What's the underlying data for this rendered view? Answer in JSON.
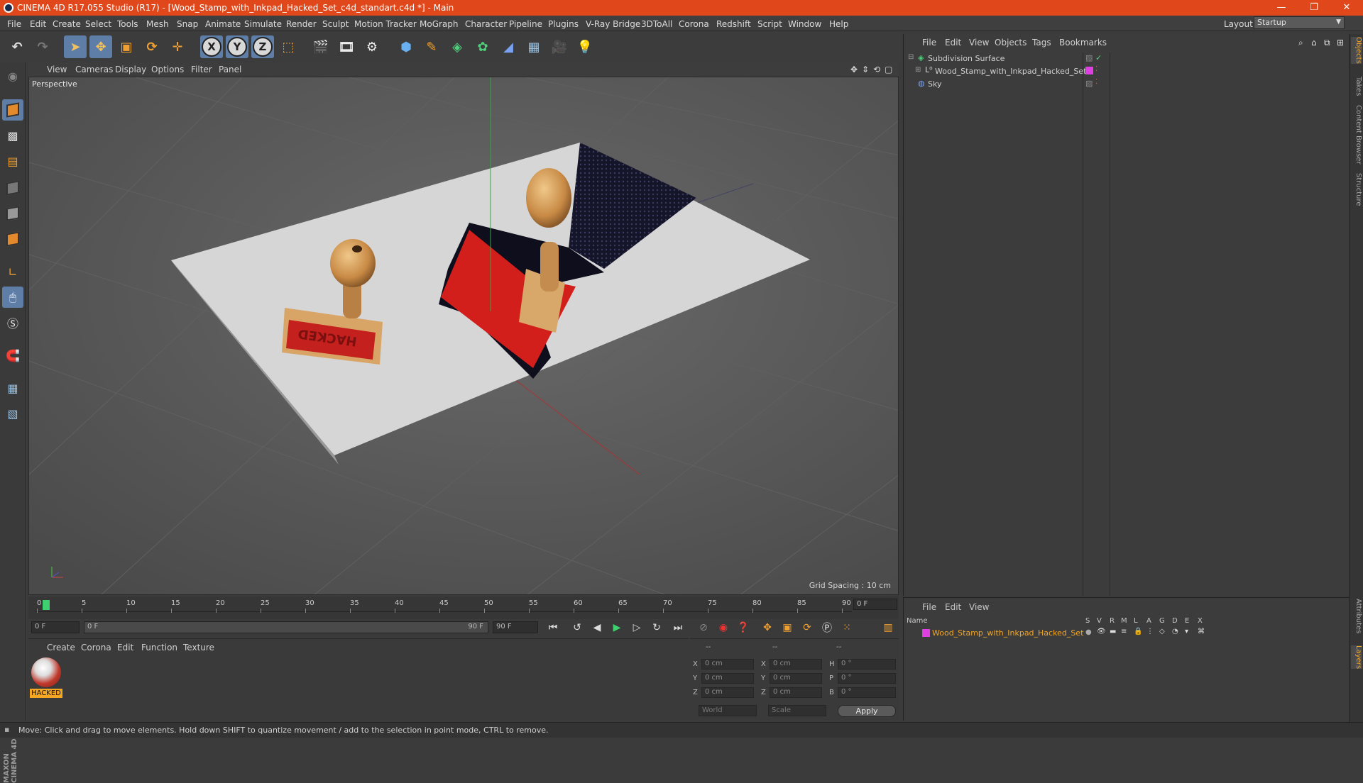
{
  "window": {
    "title": "CINEMA 4D R17.055 Studio (R17) - [Wood_Stamp_with_Inkpad_Hacked_Set_c4d_standart.c4d *] - Main",
    "minimize": "—",
    "restore": "❐",
    "close": "✕"
  },
  "menu": {
    "items": [
      "File",
      "Edit",
      "Create",
      "Select",
      "Tools",
      "Mesh",
      "Snap",
      "Animate",
      "Simulate",
      "Render",
      "Sculpt",
      "Motion Tracker",
      "MoGraph",
      "Character",
      "Pipeline",
      "Plugins",
      "V-Ray Bridge",
      "3DToAll",
      "Corona",
      "Redshift",
      "Script",
      "Window",
      "Help"
    ],
    "layout_label": "Layout:",
    "layout_value": "Startup"
  },
  "toolbar": {
    "x_label": "X",
    "y_label": "Y",
    "z_label": "Z"
  },
  "viewport": {
    "menu": [
      "View",
      "Cameras",
      "Display",
      "Options",
      "Filter",
      "Panel"
    ],
    "label": "Perspective",
    "grid_spacing": "Grid Spacing : 10 cm",
    "stamp_text": "HACKED"
  },
  "timeline": {
    "ticks": [
      "0",
      "5",
      "10",
      "15",
      "20",
      "25",
      "30",
      "35",
      "40",
      "45",
      "50",
      "55",
      "60",
      "65",
      "70",
      "75",
      "80",
      "85",
      "90"
    ],
    "current_frame": "0 F",
    "start_field": "0 F",
    "range_start": "0 F",
    "range_end": "90 F",
    "end_field": "90 F"
  },
  "material": {
    "menu": [
      "Create",
      "Corona",
      "Edit",
      "Function",
      "Texture"
    ],
    "name": "HACKED"
  },
  "coordinates": {
    "header": [
      "--",
      "--",
      "--"
    ],
    "rows": [
      {
        "l1": "X",
        "v1": "0 cm",
        "l2": "X",
        "v2": "0 cm",
        "l3": "H",
        "v3": "0 °"
      },
      {
        "l1": "Y",
        "v1": "0 cm",
        "l2": "Y",
        "v2": "0 cm",
        "l3": "P",
        "v3": "0 °"
      },
      {
        "l1": "Z",
        "v1": "0 cm",
        "l2": "Z",
        "v2": "0 cm",
        "l3": "B",
        "v3": "0 °"
      }
    ],
    "world": "World",
    "scale": "Scale",
    "apply": "Apply"
  },
  "objects": {
    "menu": [
      "File",
      "Edit",
      "View",
      "Objects",
      "Tags",
      "Bookmarks"
    ],
    "items": [
      {
        "name": "Subdivision Surface"
      },
      {
        "name": "Wood_Stamp_with_Inkpad_Hacked_Set"
      },
      {
        "name": "Sky"
      }
    ]
  },
  "layers": {
    "menu": [
      "File",
      "Edit",
      "View"
    ],
    "columns": [
      "Name",
      "S",
      "V",
      "R",
      "M",
      "L",
      "A",
      "G",
      "D",
      "E",
      "X"
    ],
    "row_name": "Wood_Stamp_with_Inkpad_Hacked_Set"
  },
  "right_tabs": [
    "Objects",
    "Takes",
    "Content Browser",
    "Structure",
    "Attributes",
    "Layers"
  ],
  "status": "Move: Click and drag to move elements. Hold down SHIFT to quantize movement / add to the selection in point mode, CTRL to remove.",
  "branding": "MAXON CINEMA 4D",
  "colors": {
    "titlebar": "#e0471a",
    "accent": "#f5a623",
    "selection": "#5e7ea8",
    "layer_color": "#e040e0"
  }
}
